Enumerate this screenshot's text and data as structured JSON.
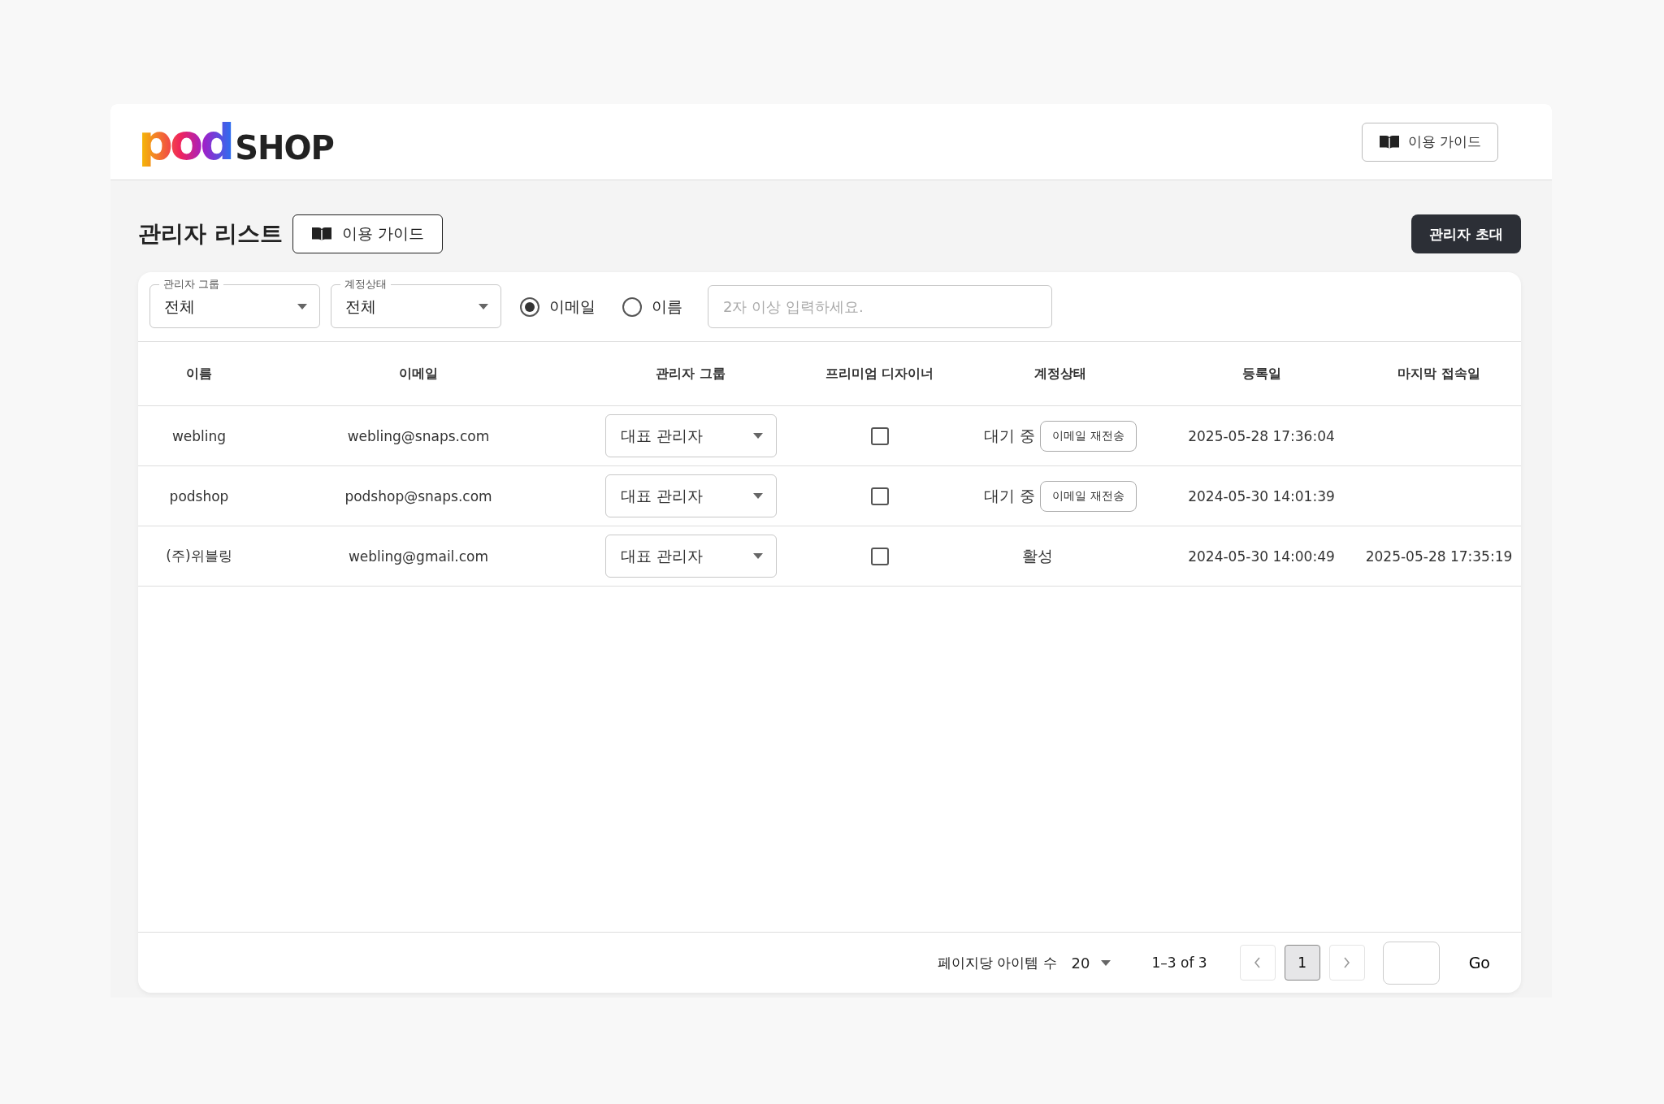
{
  "header": {
    "logo": {
      "mark": "pod",
      "text": "SHOP"
    },
    "guide_button": "이용 가이드"
  },
  "page": {
    "title": "관리자 리스트",
    "guide_button": "이용 가이드",
    "invite_button": "관리자 초대"
  },
  "filters": {
    "selects": [
      {
        "label": "관리자 그룹",
        "value": "전체"
      },
      {
        "label": "계정상태",
        "value": "전체"
      }
    ],
    "search_by": [
      {
        "label": "이메일",
        "selected": true
      },
      {
        "label": "이름",
        "selected": false
      }
    ],
    "search": {
      "placeholder": "2자 이상 입력하세요."
    }
  },
  "table": {
    "columns": [
      "이름",
      "이메일",
      "관리자 그룹",
      "프리미엄 디자이너",
      "계정상태",
      "등록일",
      "마지막 접속일"
    ],
    "rows": [
      {
        "name": "webling",
        "email": "webling@snaps.com",
        "group": "대표 관리자",
        "premium": false,
        "status": "대기 중",
        "resend_button": "이메일 재전송",
        "registered": "2025-05-28 17:36:04"
      },
      {
        "name": "podshop",
        "email": "podshop@snaps.com",
        "group": "대표 관리자",
        "premium": false,
        "status": "대기 중",
        "resend_button": "이메일 재전송",
        "registered": "2024-05-30 14:01:39"
      },
      {
        "name": "(주)위블링",
        "email": "webling@gmail.com",
        "group": "대표 관리자",
        "premium": false,
        "status": "활성",
        "registered": "2024-05-30 14:00:49",
        "last_login": "2025-05-28 17:35:19"
      }
    ]
  },
  "pagination": {
    "per_page_label": "페이지당 아이템 수",
    "per_page": "20",
    "range": "1–3 of 3",
    "pages": [
      {
        "label": "1",
        "selected": true
      }
    ],
    "go_button": "Go"
  }
}
